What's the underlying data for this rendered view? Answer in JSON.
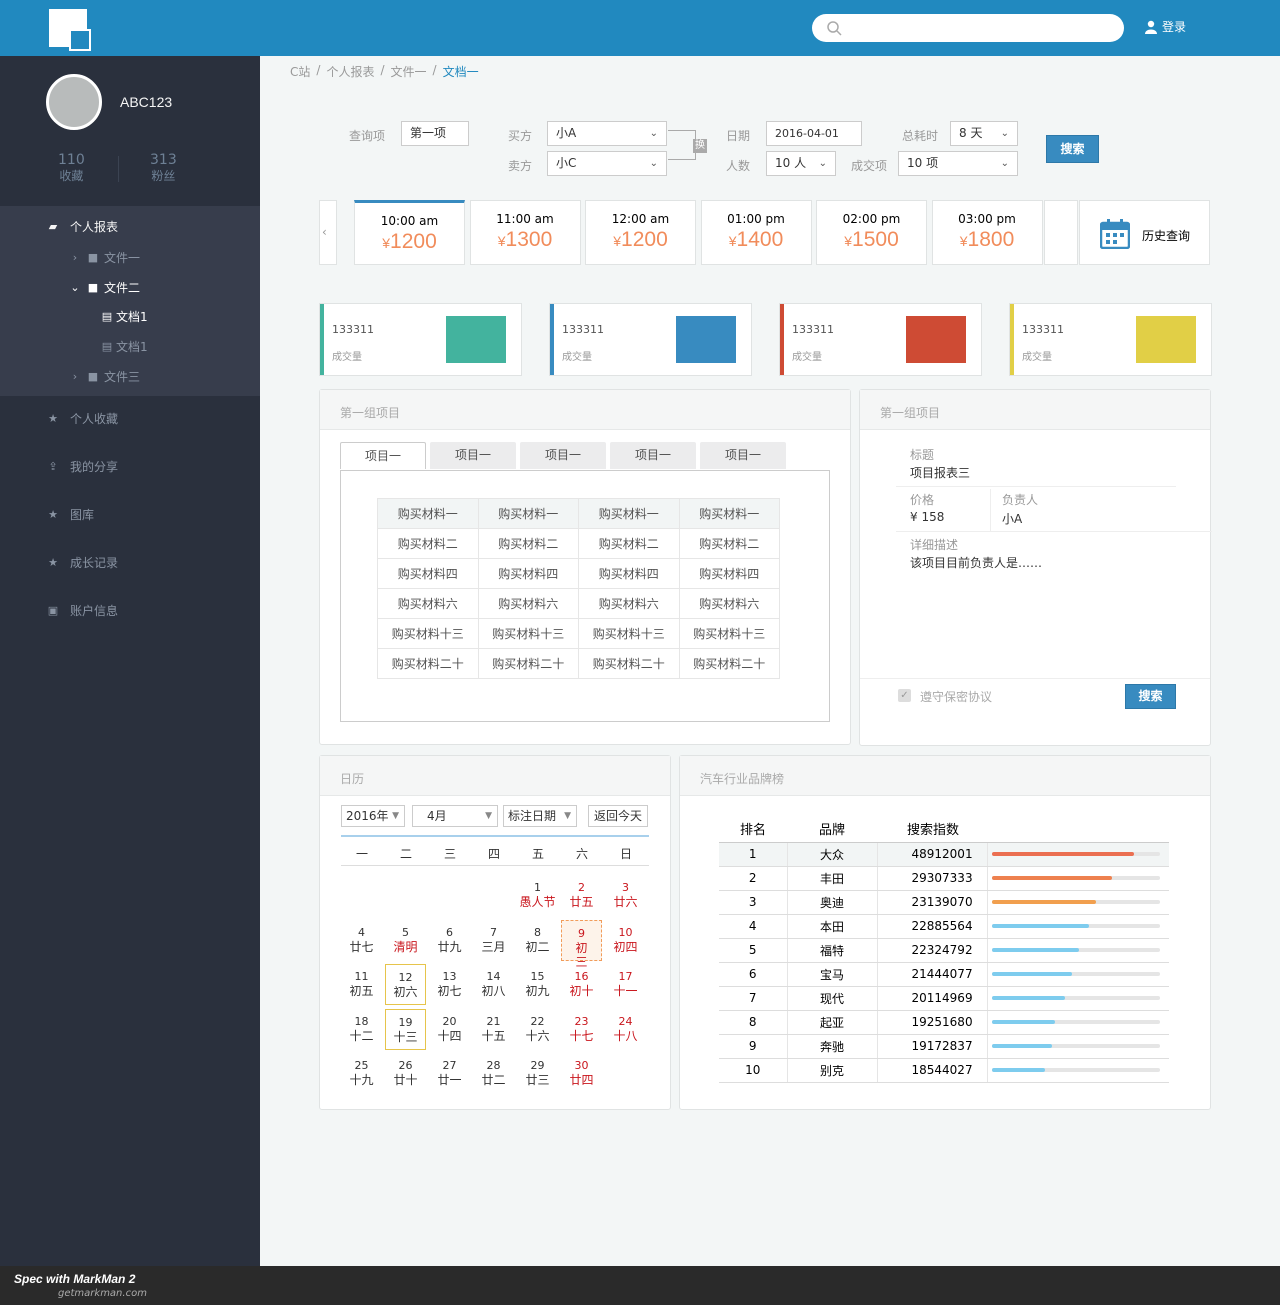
{
  "header": {
    "login": "登录",
    "search_placeholder": ""
  },
  "profile": {
    "name": "ABC123",
    "fav_count": "110",
    "fav_label": "收藏",
    "fans_count": "313",
    "fans_label": "粉丝"
  },
  "nav": {
    "report": "个人报表",
    "file1": "文件一",
    "file2": "文件二",
    "doc1a": "文档1",
    "doc1b": "文档1",
    "file3": "文件三",
    "fav": "个人收藏",
    "share": "我的分享",
    "gallery": "图库",
    "growth": "成长记录",
    "account": "账户信息"
  },
  "breadcrumb": [
    "C站",
    "/",
    "个人报表",
    "/",
    "文件一",
    "/",
    "文档一"
  ],
  "query": {
    "item_label": "查询项",
    "item_value": "第一项",
    "buyer_label": "买方",
    "buyer_value": "小A",
    "seller_label": "卖方",
    "seller_value": "小C",
    "swap": "换",
    "date_label": "日期",
    "date_value": "2016-04-01",
    "people_label": "人数",
    "people_value": "10 人",
    "duration_label": "总耗时",
    "duration_value": "8 天",
    "deal_label": "成交项",
    "deal_value": "10 项",
    "search_btn": "搜索"
  },
  "times": [
    {
      "time": "10:00 am",
      "price": "1200"
    },
    {
      "time": "11:00 am",
      "price": "1300"
    },
    {
      "time": "12:00 am",
      "price": "1200"
    },
    {
      "time": "01:00 pm",
      "price": "1400"
    },
    {
      "time": "02:00 pm",
      "price": "1500"
    },
    {
      "time": "03:00 pm",
      "price": "1800"
    }
  ],
  "currency": "¥",
  "history": "历史查询",
  "stats": [
    {
      "value": "133311",
      "label": "成交量",
      "color": "#43b39e"
    },
    {
      "value": "133311",
      "label": "成交量",
      "color": "#388bc0"
    },
    {
      "value": "133311",
      "label": "成交量",
      "color": "#ce4b34"
    },
    {
      "value": "133311",
      "label": "成交量",
      "color": "#e1cf46"
    }
  ],
  "group1": {
    "title": "第一组项目",
    "tabs": [
      "项目一",
      "项目一",
      "项目一",
      "项目一",
      "项目一"
    ],
    "rows": [
      [
        "购买材料一",
        "购买材料一",
        "购买材料一",
        "购买材料一"
      ],
      [
        "购买材料二",
        "购买材料二",
        "购买材料二",
        "购买材料二"
      ],
      [
        "购买材料四",
        "购买材料四",
        "购买材料四",
        "购买材料四"
      ],
      [
        "购买材料六",
        "购买材料六",
        "购买材料六",
        "购买材料六"
      ],
      [
        "购买材料十三",
        "购买材料十三",
        "购买材料十三",
        "购买材料十三"
      ],
      [
        "购买材料二十",
        "购买材料二十",
        "购买材料二十",
        "购买材料二十"
      ]
    ]
  },
  "group2": {
    "title": "第一组项目",
    "title_label": "标题",
    "title_value": "项目报表三",
    "price_label": "价格",
    "price_value": "¥ 158",
    "owner_label": "负责人",
    "owner_value": "小A",
    "desc_label": "详细描述",
    "desc_value": "该项目目前负责人是……",
    "agree": "遵守保密协议",
    "search_btn": "搜索"
  },
  "calendar": {
    "title": "日历",
    "year": "2016年",
    "month": "4月",
    "mark": "标注日期",
    "today": "返回今天",
    "weekdays": [
      "一",
      "二",
      "三",
      "四",
      "五",
      "六",
      "日"
    ],
    "days": [
      {
        "n": "1",
        "l": "愚人节",
        "col": 4,
        "row": 0,
        "red": false,
        "festival": true
      },
      {
        "n": "2",
        "l": "廿五",
        "col": 5,
        "row": 0,
        "red": true
      },
      {
        "n": "3",
        "l": "廿六",
        "col": 6,
        "row": 0,
        "red": true
      },
      {
        "n": "4",
        "l": "廿七",
        "col": 0,
        "row": 1
      },
      {
        "n": "5",
        "l": "清明",
        "col": 1,
        "row": 1,
        "festival": true
      },
      {
        "n": "6",
        "l": "廿九",
        "col": 2,
        "row": 1
      },
      {
        "n": "7",
        "l": "三月",
        "col": 3,
        "row": 1
      },
      {
        "n": "8",
        "l": "初二",
        "col": 4,
        "row": 1
      },
      {
        "n": "9",
        "l": "初三",
        "col": 5,
        "row": 1,
        "red": true,
        "selected": true
      },
      {
        "n": "10",
        "l": "初四",
        "col": 6,
        "row": 1,
        "red": true
      },
      {
        "n": "11",
        "l": "初五",
        "col": 0,
        "row": 2
      },
      {
        "n": "12",
        "l": "初六",
        "col": 1,
        "row": 2,
        "boxed": true
      },
      {
        "n": "13",
        "l": "初七",
        "col": 2,
        "row": 2
      },
      {
        "n": "14",
        "l": "初八",
        "col": 3,
        "row": 2
      },
      {
        "n": "15",
        "l": "初九",
        "col": 4,
        "row": 2
      },
      {
        "n": "16",
        "l": "初十",
        "col": 5,
        "row": 2,
        "red": true
      },
      {
        "n": "17",
        "l": "十一",
        "col": 6,
        "row": 2,
        "red": true
      },
      {
        "n": "18",
        "l": "十二",
        "col": 0,
        "row": 3
      },
      {
        "n": "19",
        "l": "十三",
        "col": 1,
        "row": 3,
        "boxed": true
      },
      {
        "n": "20",
        "l": "十四",
        "col": 2,
        "row": 3
      },
      {
        "n": "21",
        "l": "十五",
        "col": 3,
        "row": 3
      },
      {
        "n": "22",
        "l": "十六",
        "col": 4,
        "row": 3
      },
      {
        "n": "23",
        "l": "十七",
        "col": 5,
        "row": 3,
        "red": true
      },
      {
        "n": "24",
        "l": "十八",
        "col": 6,
        "row": 3,
        "red": true
      },
      {
        "n": "25",
        "l": "十九",
        "col": 0,
        "row": 4
      },
      {
        "n": "26",
        "l": "廿十",
        "col": 1,
        "row": 4
      },
      {
        "n": "27",
        "l": "廿一",
        "col": 2,
        "row": 4
      },
      {
        "n": "28",
        "l": "廿二",
        "col": 3,
        "row": 4
      },
      {
        "n": "29",
        "l": "廿三",
        "col": 4,
        "row": 4
      },
      {
        "n": "30",
        "l": "廿四",
        "col": 5,
        "row": 4,
        "red": true
      }
    ]
  },
  "ranking": {
    "title": "汽车行业品牌榜",
    "headers": [
      "排名",
      "品牌",
      "搜索指数"
    ],
    "rows": [
      {
        "rank": "1",
        "brand": "大众",
        "index": "48912001",
        "fill": 0.85,
        "color": "#eb6f51"
      },
      {
        "rank": "2",
        "brand": "丰田",
        "index": "29307333",
        "fill": 0.72,
        "color": "#ee814f"
      },
      {
        "rank": "3",
        "brand": "奥迪",
        "index": "23139070",
        "fill": 0.62,
        "color": "#f19f4e"
      },
      {
        "rank": "4",
        "brand": "本田",
        "index": "22885564",
        "fill": 0.58,
        "color": "#7eccee"
      },
      {
        "rank": "5",
        "brand": "福特",
        "index": "22324792",
        "fill": 0.52,
        "color": "#7eccee"
      },
      {
        "rank": "6",
        "brand": "宝马",
        "index": "21444077",
        "fill": 0.48,
        "color": "#7eccee"
      },
      {
        "rank": "7",
        "brand": "现代",
        "index": "20114969",
        "fill": 0.44,
        "color": "#7eccee"
      },
      {
        "rank": "8",
        "brand": "起亚",
        "index": "19251680",
        "fill": 0.38,
        "color": "#7eccee"
      },
      {
        "rank": "9",
        "brand": "奔驰",
        "index": "19172837",
        "fill": 0.36,
        "color": "#7eccee"
      },
      {
        "rank": "10",
        "brand": "别克",
        "index": "18544027",
        "fill": 0.32,
        "color": "#7eccee"
      }
    ]
  },
  "footer": {
    "brand": "Spec with MarkMan 2",
    "url": "getmarkman.com"
  }
}
